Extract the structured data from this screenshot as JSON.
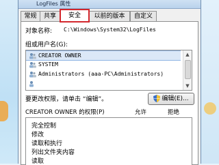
{
  "window": {
    "title": "LogFiles 属性"
  },
  "tabs": [
    {
      "label": "常规"
    },
    {
      "label": "共享"
    },
    {
      "label": "安全"
    },
    {
      "label": "以前的版本"
    },
    {
      "label": "自定义"
    }
  ],
  "object": {
    "label": "对象名称:",
    "value": "C:\\Windows\\System32\\LogFiles"
  },
  "group": {
    "label": "组或用户名(G):",
    "users": [
      {
        "name": "CREATOR OWNER"
      },
      {
        "name": "SYSTEM"
      },
      {
        "name": "Administrators (aaa-PC\\Administrators)"
      },
      {
        "name": ""
      }
    ]
  },
  "change_hint": "要更改权限，请单击 “编辑”。",
  "edit_button": {
    "label": "编辑(E)..."
  },
  "permissions": {
    "title": "CREATOR OWNER 的权限(P)",
    "allow_header": "允许",
    "deny_header": "拒绝",
    "items": [
      {
        "label": "完全控制"
      },
      {
        "label": "修改"
      },
      {
        "label": "读取和执行"
      },
      {
        "label": "列出文件夹内容"
      },
      {
        "label": "读取"
      }
    ]
  },
  "colors": {
    "accent_highlight": "#d3262c",
    "selection": "#dbe8f7"
  }
}
